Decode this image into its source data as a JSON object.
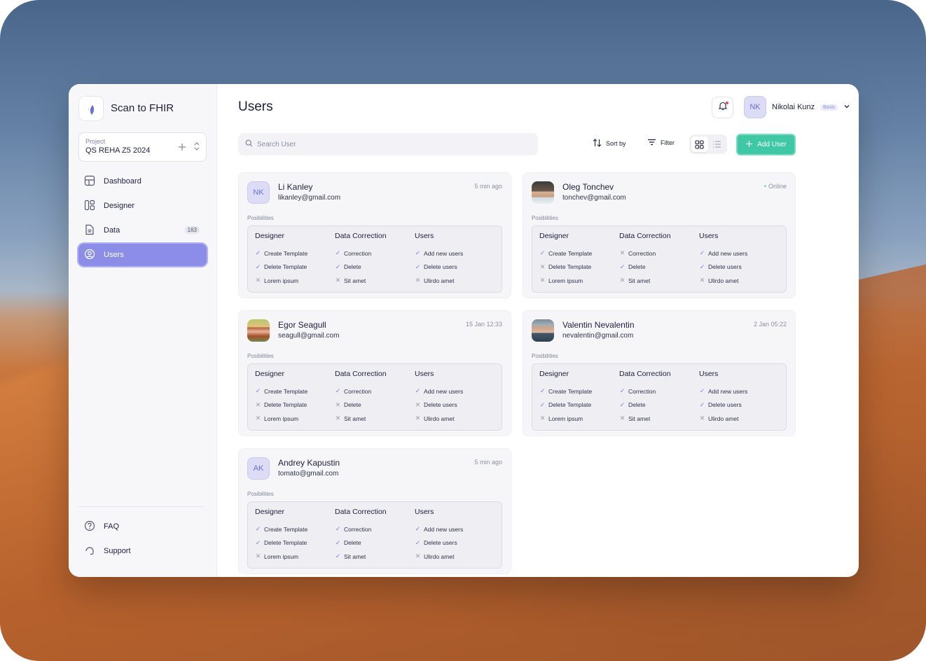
{
  "app": {
    "name": "Scan to FHIR"
  },
  "project": {
    "caption": "Project",
    "name": "QS REHA Z5 2024"
  },
  "nav": {
    "items": [
      {
        "label": "Dashboard",
        "icon": "dashboard-icon",
        "active": false
      },
      {
        "label": "Designer",
        "icon": "designer-icon",
        "active": false
      },
      {
        "label": "Data",
        "icon": "document-icon",
        "badge": "163",
        "active": false
      },
      {
        "label": "Users",
        "icon": "user-circle-icon",
        "active": true
      }
    ],
    "bottom": [
      {
        "label": "FAQ",
        "icon": "help-icon"
      },
      {
        "label": "Support",
        "icon": "support-icon"
      }
    ]
  },
  "header": {
    "title": "Users",
    "user": {
      "initials": "NK",
      "name": "Nikolai Kunz",
      "plan": "Basic"
    }
  },
  "toolbar": {
    "search_placeholder": "Search User",
    "sort_label": "Sort by",
    "filter_label": "Filter",
    "add_label": "Add User",
    "accent": "#3fc8a6"
  },
  "permissions_caption": "Posibilities",
  "users": [
    {
      "name": "Li Kanley",
      "email": "likanley@gmail.com",
      "initials": "NK",
      "photo": false,
      "status": "5 min ago",
      "groups": [
        {
          "title": "Designer",
          "items": [
            {
              "label": "Create Template",
              "ok": true
            },
            {
              "label": "Delete Template",
              "ok": true
            },
            {
              "label": "Lorem ipsum",
              "ok": false
            }
          ]
        },
        {
          "title": "Data Correction",
          "items": [
            {
              "label": "Correction",
              "ok": true
            },
            {
              "label": "Delete",
              "ok": true
            },
            {
              "label": "Sit amet",
              "ok": false
            }
          ]
        },
        {
          "title": "Users",
          "items": [
            {
              "label": "Add new users",
              "ok": true
            },
            {
              "label": "Delete users",
              "ok": true
            },
            {
              "label": "Ulirdo amet",
              "ok": false
            }
          ]
        }
      ]
    },
    {
      "name": "Oleg Tonchev",
      "email": "tonchev@gmail.com",
      "initials": "",
      "photo": true,
      "status": "Online",
      "groups": [
        {
          "title": "Designer",
          "items": [
            {
              "label": "Create Template",
              "ok": true
            },
            {
              "label": "Delete Template",
              "ok": false
            },
            {
              "label": "Lorem ipsum",
              "ok": false
            }
          ]
        },
        {
          "title": "Data Correction",
          "items": [
            {
              "label": "Correction",
              "ok": false
            },
            {
              "label": "Delete",
              "ok": true
            },
            {
              "label": "Sit amet",
              "ok": false
            }
          ]
        },
        {
          "title": "Users",
          "items": [
            {
              "label": "Add new users",
              "ok": true
            },
            {
              "label": "Delete users",
              "ok": true
            },
            {
              "label": "Ulirdo amet",
              "ok": false
            }
          ]
        }
      ]
    },
    {
      "name": "Egor Seagull",
      "email": "seagull@gmail.com",
      "initials": "",
      "photo": true,
      "status": "15 Jan 12:33",
      "groups": [
        {
          "title": "Designer",
          "items": [
            {
              "label": "Create Template",
              "ok": true
            },
            {
              "label": "Delete Template",
              "ok": false
            },
            {
              "label": "Lorem ipsum",
              "ok": false
            }
          ]
        },
        {
          "title": "Data Correction",
          "items": [
            {
              "label": "Correction",
              "ok": true
            },
            {
              "label": "Delete",
              "ok": false
            },
            {
              "label": "Sit amet",
              "ok": false
            }
          ]
        },
        {
          "title": "Users",
          "items": [
            {
              "label": "Add new users",
              "ok": true
            },
            {
              "label": "Delete users",
              "ok": false
            },
            {
              "label": "Ulirdo amet",
              "ok": false
            }
          ]
        }
      ]
    },
    {
      "name": "Valentin Nevalentin",
      "email": "nevalentin@gmail.com",
      "initials": "",
      "photo": true,
      "status": "2 Jan 05:22",
      "groups": [
        {
          "title": "Designer",
          "items": [
            {
              "label": "Create Template",
              "ok": true
            },
            {
              "label": "Delete Template",
              "ok": true
            },
            {
              "label": "Lorem ipsum",
              "ok": false
            }
          ]
        },
        {
          "title": "Data Correction",
          "items": [
            {
              "label": "Correction",
              "ok": true
            },
            {
              "label": "Delete",
              "ok": true
            },
            {
              "label": "Sit amet",
              "ok": false
            }
          ]
        },
        {
          "title": "Users",
          "items": [
            {
              "label": "Add new users",
              "ok": true
            },
            {
              "label": "Delete users",
              "ok": true
            },
            {
              "label": "Ulirdo amet",
              "ok": false
            }
          ]
        }
      ]
    },
    {
      "name": "Andrey Kapustin",
      "email": "tomato@gmail.com",
      "initials": "AK",
      "photo": false,
      "status": "5 min ago",
      "groups": [
        {
          "title": "Designer",
          "items": [
            {
              "label": "Create Template",
              "ok": true
            },
            {
              "label": "Delete Template",
              "ok": true
            },
            {
              "label": "Lorem ipsum",
              "ok": false
            }
          ]
        },
        {
          "title": "Data Correction",
          "items": [
            {
              "label": "Correction",
              "ok": true
            },
            {
              "label": "Delete",
              "ok": true
            },
            {
              "label": "Sit amet",
              "ok": true
            }
          ]
        },
        {
          "title": "Users",
          "items": [
            {
              "label": "Add new users",
              "ok": true
            },
            {
              "label": "Delete users",
              "ok": true
            },
            {
              "label": "Ulirdo amet",
              "ok": false
            }
          ]
        }
      ]
    }
  ]
}
